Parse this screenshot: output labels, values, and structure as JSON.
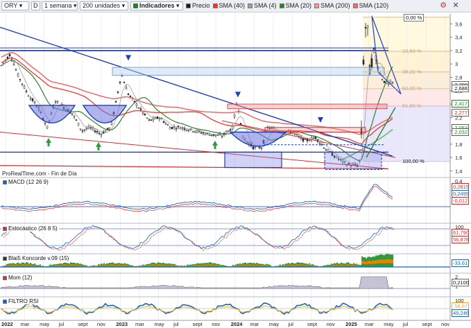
{
  "toolbar": {
    "symbol": "ORY",
    "period_code": "D",
    "period": "1 semana",
    "bars": "200 unidades",
    "indicators_label": "Indicadores",
    "legend": [
      {
        "label": "Precio",
        "color": "#1a1a1a"
      },
      {
        "label": "SMA (40)",
        "color": "#e53935"
      },
      {
        "label": "SMA (4)",
        "color": "#9e9e9e"
      },
      {
        "label": "SMA (20)",
        "color": "#2e7d32"
      },
      {
        "label": "SMA (200)",
        "color": "#ef9a9a"
      },
      {
        "label": "SMA (120)",
        "color": "#e57373"
      }
    ]
  },
  "source_label": "ProRealTime.com - Fin de Día",
  "price_axis": {
    "ticks": [
      "3,6",
      "3,4",
      "3,2",
      "3",
      "2,8",
      "2,6",
      "2,4",
      "2,2",
      "2",
      "1,8",
      "1,6",
      "1,4"
    ],
    "badges": [
      {
        "text": "2,700",
        "bg": "#ffffff",
        "fg": "#111",
        "y": 2.7
      },
      {
        "text": "2,688",
        "bg": "#ffffff",
        "fg": "#111",
        "y": 2.64
      },
      {
        "text": "2,417",
        "bg": "#ffffff",
        "fg": "#2e7d32",
        "y": 2.42
      },
      {
        "text": "2,277",
        "bg": "#ffffff",
        "fg": "#d32f2f",
        "y": 2.28
      },
      {
        "text": "2,053",
        "bg": "#ffffff",
        "fg": "#2e7d32",
        "y": 2.05
      },
      {
        "text": "2,032",
        "bg": "#ffffff",
        "fg": "#2e7d32",
        "y": 1.99
      }
    ]
  },
  "fibonacci": [
    {
      "label": "0,00 %",
      "value": 3.7
    },
    {
      "label": "23,60 %",
      "value": 3.19
    },
    {
      "label": "38,20 %",
      "value": 2.88
    },
    {
      "label": "50,00 %",
      "value": 2.63
    },
    {
      "label": "61,80 %",
      "value": 2.37
    },
    {
      "label": "100,00 %",
      "value": 1.54
    }
  ],
  "x_axis": {
    "labels": [
      {
        "text": "2022",
        "bold": true
      },
      {
        "text": "mar"
      },
      {
        "text": "may"
      },
      {
        "text": "jul"
      },
      {
        "text": "sept"
      },
      {
        "text": "nov"
      },
      {
        "text": "2023",
        "bold": true
      },
      {
        "text": "mar"
      },
      {
        "text": "may"
      },
      {
        "text": "jul"
      },
      {
        "text": "sept"
      },
      {
        "text": "nov"
      },
      {
        "text": "2024",
        "bold": true
      },
      {
        "text": "mar"
      },
      {
        "text": "may"
      },
      {
        "text": "jul"
      },
      {
        "text": "sept"
      },
      {
        "text": "nov"
      },
      {
        "text": "2025",
        "bold": true
      },
      {
        "text": "mar"
      },
      {
        "text": "may"
      },
      {
        "text": "jul"
      },
      {
        "text": "sept"
      },
      {
        "text": "nov"
      }
    ]
  },
  "panes": [
    {
      "id": "macd",
      "label": "MACD (12 26 9)",
      "swatch": "#1565c0",
      "ticks": [
        "0,4",
        "0,2"
      ],
      "badges": [
        {
          "text": "0,2815",
          "fg": "#d32f2f"
        },
        {
          "text": "0,2495",
          "fg": "#1565c0"
        },
        {
          "text": "-0,012",
          "fg": "#d32f2f"
        }
      ]
    },
    {
      "id": "stoch",
      "label": "Estocástico (26 8 5)",
      "swatch": "#d32f2f",
      "ticks": [
        "100",
        "50"
      ],
      "badges": [
        {
          "text": "61,790",
          "fg": "#d32f2f"
        },
        {
          "text": "56,878",
          "fg": "#d32f2f"
        }
      ]
    },
    {
      "id": "blai",
      "label": "Blai5 Koncorde v.09 (15)",
      "swatch": "#333",
      "ticks": [],
      "badges": [
        {
          "text": "-33,61",
          "fg": "#1565c0"
        }
      ]
    },
    {
      "id": "mom",
      "label": "Mom (12)",
      "swatch": "#d32f2f",
      "ticks": [
        "2",
        "1"
      ],
      "badges": [
        {
          "text": "0,2100",
          "fg": "#111"
        }
      ]
    },
    {
      "id": "rsi",
      "label": "FILTRO RSI",
      "swatch": "#1565c0",
      "ticks": [
        "100"
      ],
      "badges": [
        {
          "text": "58,07",
          "fg": "#f9a825"
        },
        {
          "text": "49,246",
          "fg": "#1565c0"
        }
      ]
    }
  ],
  "icons": {
    "settings": "gear-icon",
    "close": "close-icon"
  }
}
